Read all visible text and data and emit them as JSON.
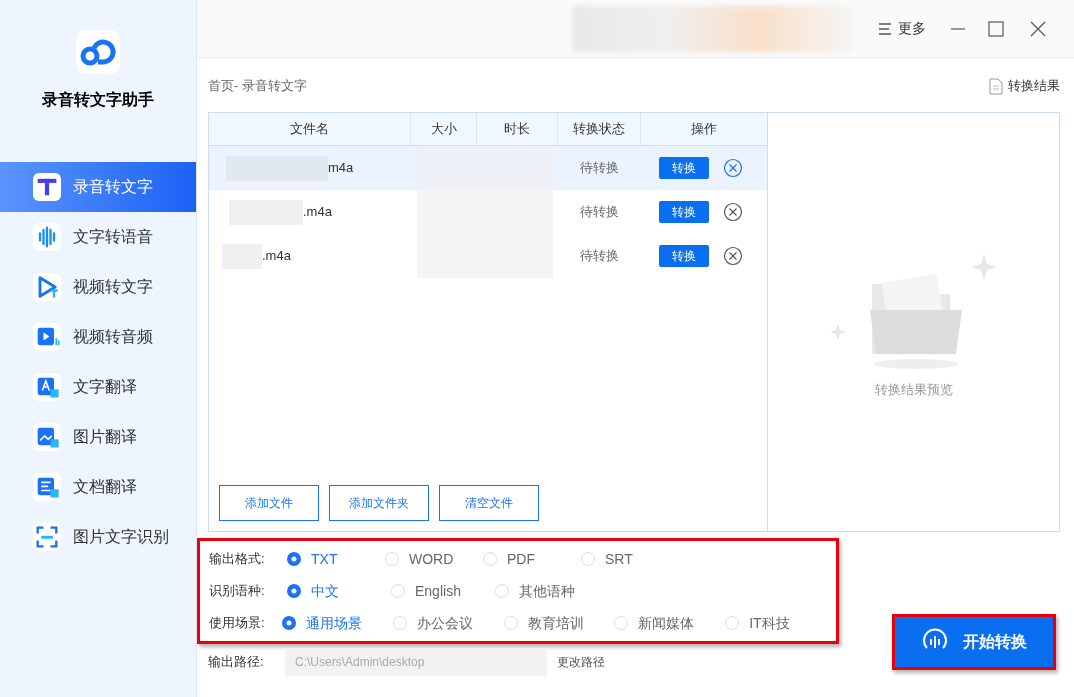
{
  "app": {
    "title": "录音转文字助手"
  },
  "sidebar": {
    "items": [
      {
        "label": "录音转文字",
        "selected": true,
        "kind": "text"
      },
      {
        "label": "文字转语音",
        "selected": false,
        "kind": "wave"
      },
      {
        "label": "视频转文字",
        "selected": false,
        "kind": "play"
      },
      {
        "label": "视频转音频",
        "selected": false,
        "kind": "video"
      },
      {
        "label": "文字翻译",
        "selected": false,
        "kind": "translate"
      },
      {
        "label": "图片翻译",
        "selected": false,
        "kind": "image"
      },
      {
        "label": "文档翻译",
        "selected": false,
        "kind": "doc"
      },
      {
        "label": "图片文字识别",
        "selected": false,
        "kind": "scan"
      }
    ]
  },
  "titlebar": {
    "menu": "更多"
  },
  "breadcrumb": "首页- 录音转文字",
  "results_link": "转换结果",
  "table": {
    "columns": [
      "文件名",
      "大小",
      "时长",
      "转换状态",
      "操作"
    ],
    "rows": [
      {
        "file": "m4a",
        "status": "待转换",
        "action": "转换",
        "selected": true
      },
      {
        "file": ".m4a",
        "status": "待转换",
        "action": "转换",
        "selected": false
      },
      {
        "file": ".m4a",
        "status": "待转换",
        "action": "转换",
        "selected": false
      }
    ]
  },
  "file_buttons": [
    "添加文件",
    "添加文件夹",
    "清空文件"
  ],
  "preview": {
    "label": "转换结果预览"
  },
  "options": [
    {
      "label": "输出格式:",
      "choices": [
        {
          "label": "TXT",
          "selected": true
        },
        {
          "label": "WORD",
          "selected": false
        },
        {
          "label": "PDF",
          "selected": false
        },
        {
          "label": "SRT",
          "selected": false
        }
      ]
    },
    {
      "label": "识别语种:",
      "choices": [
        {
          "label": "中文",
          "selected": true
        },
        {
          "label": "English",
          "selected": false
        },
        {
          "label": "其他语种",
          "selected": false
        }
      ]
    },
    {
      "label": "使用场景:",
      "choices": [
        {
          "label": "通用场景",
          "selected": true
        },
        {
          "label": "办公会议",
          "selected": false
        },
        {
          "label": "教育培训",
          "selected": false
        },
        {
          "label": "新闻媒体",
          "selected": false
        },
        {
          "label": "IT科技",
          "selected": false
        }
      ]
    }
  ],
  "output_path": {
    "label": "输出路径:",
    "value": "C:\\Users\\Admin\\desktop",
    "change": "更改路径"
  },
  "start_button": "开始转换"
}
